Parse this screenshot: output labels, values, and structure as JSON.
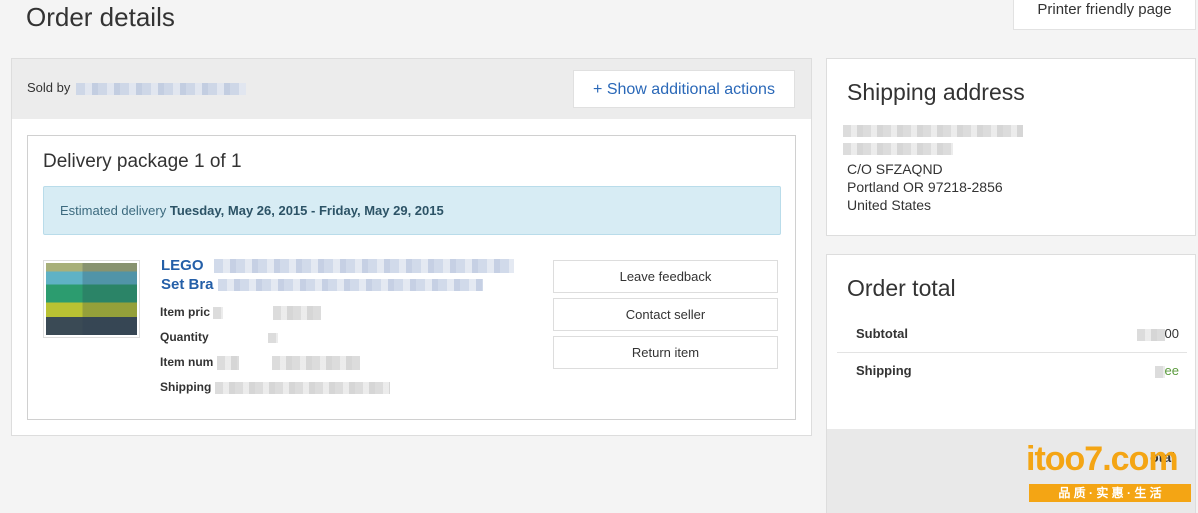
{
  "page": {
    "title": "Order details",
    "printer_label": "Printer friendly page"
  },
  "order": {
    "sold_by_label": "Sold by",
    "show_actions_label": "+ Show additional actions",
    "package_title": "Delivery package 1 of 1",
    "estimate_label": "Estimated delivery",
    "estimate_dates": "Tuesday, May 26, 2015 - Friday, May 29, 2015",
    "item": {
      "name_line1": "LEGO",
      "name_line2": "Set Bra",
      "labels": [
        "Item pric",
        "Quantity",
        "Item num",
        "Shipping"
      ]
    },
    "actions": [
      "Leave feedback",
      "Contact seller",
      "Return item"
    ]
  },
  "shipping": {
    "title": "Shipping address",
    "lines": [
      "C/O SFZAQND",
      "Portland OR 97218-2856",
      "United States"
    ]
  },
  "totals": {
    "title": "Order total",
    "rows": [
      {
        "label": "Subtotal",
        "value": "00"
      },
      {
        "label": "Shipping",
        "value": "ee"
      }
    ],
    "footer_label": "otal"
  },
  "watermark": {
    "brand": "itoo7.com",
    "tagline": "品 质 · 实 惠 · 生 活"
  },
  "colors": {
    "link_blue": "#2a68b8",
    "estimate_bg": "#d7ecf4",
    "free_green": "#5a9a3c",
    "watermark_orange": "#f4a514"
  }
}
